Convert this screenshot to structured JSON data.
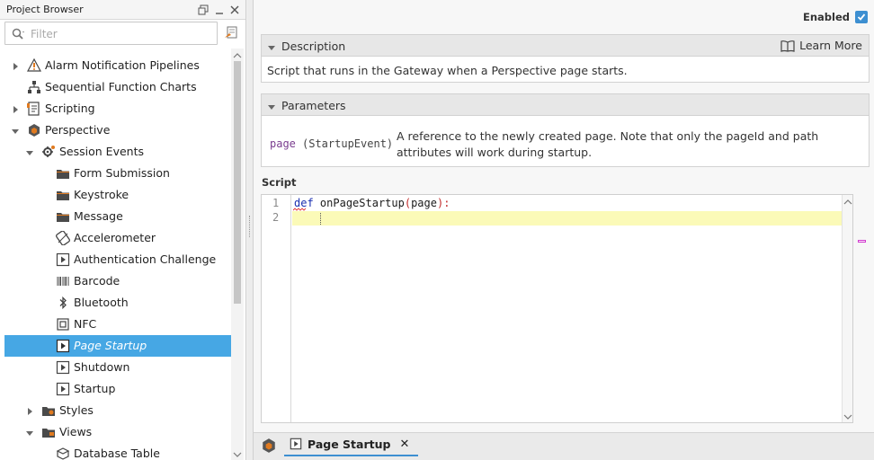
{
  "project_browser": {
    "title": "Project Browser",
    "filter_placeholder": "Filter",
    "tree": [
      {
        "label": "Alarm Notification Pipelines",
        "icon": "alarm-pipeline-icon",
        "expandable": true,
        "expanded": false
      },
      {
        "label": "Sequential Function Charts",
        "icon": "sfc-icon",
        "expandable": false
      },
      {
        "label": "Scripting",
        "icon": "scripting-icon",
        "expandable": true,
        "expanded": false
      },
      {
        "label": "Perspective",
        "icon": "perspective-icon",
        "expandable": true,
        "expanded": true
      },
      {
        "label": "Session Events",
        "icon": "gear-folder-icon",
        "expandable": true,
        "expanded": true
      },
      {
        "label": "Form Submission",
        "icon": "folder-icon"
      },
      {
        "label": "Keystroke",
        "icon": "folder-icon"
      },
      {
        "label": "Message",
        "icon": "folder-icon"
      },
      {
        "label": "Accelerometer",
        "icon": "accelerometer-icon"
      },
      {
        "label": "Authentication Challenge",
        "icon": "script-event-icon"
      },
      {
        "label": "Barcode",
        "icon": "barcode-icon"
      },
      {
        "label": "Bluetooth",
        "icon": "bluetooth-icon"
      },
      {
        "label": "NFC",
        "icon": "nfc-icon"
      },
      {
        "label": "Page Startup",
        "icon": "script-event-icon",
        "selected": true
      },
      {
        "label": "Shutdown",
        "icon": "script-event-icon"
      },
      {
        "label": "Startup",
        "icon": "script-event-icon"
      },
      {
        "label": "Styles",
        "icon": "styles-icon",
        "expandable": true,
        "expanded": false
      },
      {
        "label": "Views",
        "icon": "views-icon",
        "expandable": true,
        "expanded": true
      },
      {
        "label": "Database Table",
        "icon": "view-icon"
      }
    ]
  },
  "editor_panel": {
    "enabled_label": "Enabled",
    "enabled": true,
    "description": {
      "title": "Description",
      "learn_more": "Learn More",
      "text": "Script that runs in the Gateway when a Perspective page starts."
    },
    "parameters": {
      "title": "Parameters",
      "name": "page",
      "type": "(StartupEvent)",
      "description": "A reference to the newly created page. Note that only the pageId and path attributes will work during startup."
    },
    "script": {
      "label": "Script",
      "line_numbers": [
        "1",
        "2"
      ],
      "keyword": "def",
      "function_name": "onPageStartup",
      "open_paren": "(",
      "param": "page",
      "close": "):"
    }
  },
  "tabs": {
    "active_label": "Page Startup",
    "close_glyph": "✕"
  },
  "colors": {
    "selection": "#46a7e4",
    "accent": "#3d8fd1",
    "keyword": "#1a2fb0",
    "current_line": "#fbfab8"
  }
}
